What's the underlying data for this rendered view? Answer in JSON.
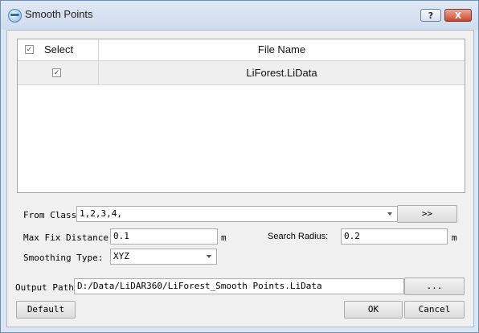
{
  "window": {
    "title": "Smooth Points",
    "help_label": "?",
    "close_label": "X",
    "app_icon": "lidar360-logo-icon"
  },
  "table": {
    "columns": [
      "Select",
      "File Name"
    ],
    "header_select_checked": "✓",
    "rows": [
      {
        "checked": "✓",
        "file_name": "LiForest.LiData"
      }
    ]
  },
  "form": {
    "from_class_label": "From Class:",
    "from_class_value": "1,2,3,4,",
    "from_class_button": ">>",
    "max_fix_distance_label": "Max Fix Distance:",
    "max_fix_distance_value": "0.1",
    "max_fix_distance_unit": "m",
    "search_radius_label": "Search Radius:",
    "search_radius_value": "0.2",
    "search_radius_unit": "m",
    "smoothing_type_label": "Smoothing Type:",
    "smoothing_type_value": "XYZ",
    "output_path_label": "Output Path:",
    "output_path_value": "D:/Data/LiDAR360/LiForest_Smooth Points.LiData",
    "browse_button": "..."
  },
  "buttons": {
    "default": "Default",
    "ok": "OK",
    "cancel": "Cancel"
  }
}
